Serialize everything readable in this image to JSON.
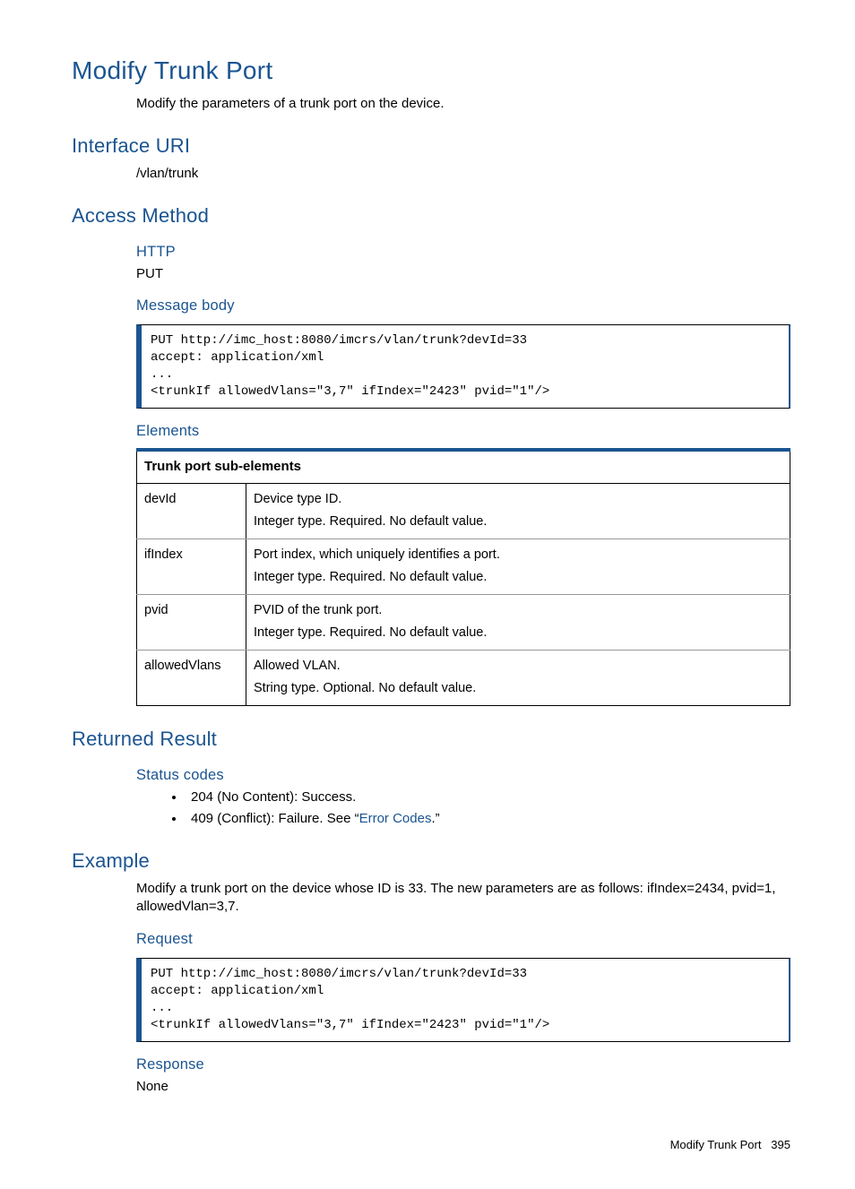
{
  "title": "Modify Trunk Port",
  "intro": "Modify the parameters of a trunk port on the device.",
  "interface_uri": {
    "heading": "Interface URI",
    "value": "/vlan/trunk"
  },
  "access_method": {
    "heading": "Access Method",
    "http_label": "HTTP",
    "http_value": "PUT",
    "message_body_label": "Message body",
    "message_body_code": "PUT http://imc_host:8080/imcrs/vlan/trunk?devId=33\naccept: application/xml\n...\n<trunkIf allowedVlans=\"3,7\" ifIndex=\"2423\" pvid=\"1\"/>",
    "elements_label": "Elements",
    "table_header": "Trunk port sub-elements",
    "rows": [
      {
        "name": "devId",
        "desc1": "Device type ID.",
        "desc2": "Integer type. Required. No default value."
      },
      {
        "name": "ifIndex",
        "desc1": "Port index, which uniquely identifies a port.",
        "desc2": "Integer type. Required. No default value."
      },
      {
        "name": "pvid",
        "desc1": "PVID of the trunk port.",
        "desc2": "Integer type. Required. No default value."
      },
      {
        "name": "allowedVlans",
        "desc1": "Allowed VLAN.",
        "desc2": "String type. Optional. No default value."
      }
    ]
  },
  "returned_result": {
    "heading": "Returned Result",
    "status_label": "Status codes",
    "codes": {
      "c0": "204 (No Content): Success.",
      "c1_pre": "409 (Conflict): Failure. See “",
      "c1_link": "Error Codes",
      "c1_post": ".”"
    }
  },
  "example": {
    "heading": "Example",
    "description": "Modify a trunk port on the device whose ID is 33. The new parameters are as follows: ifIndex=2434, pvid=1, allowedVlan=3,7.",
    "request_label": "Request",
    "request_code": "PUT http://imc_host:8080/imcrs/vlan/trunk?devId=33\naccept: application/xml\n...\n<trunkIf allowedVlans=\"3,7\" ifIndex=\"2423\" pvid=\"1\"/>",
    "response_label": "Response",
    "response_value": "None"
  },
  "footer": {
    "text": "Modify Trunk Port",
    "page": "395"
  }
}
